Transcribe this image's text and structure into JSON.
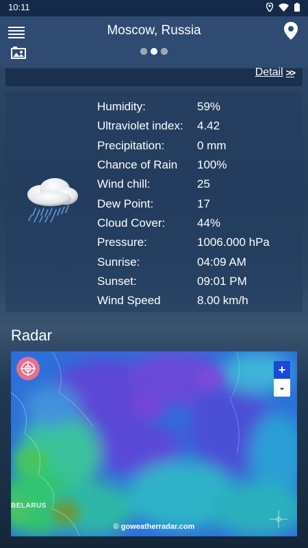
{
  "status_bar": {
    "time": "10:11"
  },
  "header": {
    "location": "Moscow, Russia",
    "page_dots": 3,
    "active_dot": 1
  },
  "detail": {
    "label": "Detail"
  },
  "weather_details": [
    {
      "label": "Humidity:",
      "value": "59%"
    },
    {
      "label": "Ultraviolet index:",
      "value": "4.42"
    },
    {
      "label": "Precipitation:",
      "value": "0 mm"
    },
    {
      "label": "Chance of Rain",
      "value": "100%"
    },
    {
      "label": "Wind chill:",
      "value": "25"
    },
    {
      "label": "Dew Point:",
      "value": "17"
    },
    {
      "label": "Cloud Cover:",
      "value": "44%"
    },
    {
      "label": "Pressure:",
      "value": "1006.000 hPa"
    },
    {
      "label": "Sunrise:",
      "value": "04:09 AM"
    },
    {
      "label": "Sunset:",
      "value": "09:01 PM"
    },
    {
      "label": "Wind Speed",
      "value": "8.00 km/h"
    }
  ],
  "radar": {
    "title": "Radar",
    "zoom_in_label": "+",
    "zoom_out_label": "-",
    "map_label": "BELARUS",
    "credit": "© goweatherradar.com"
  },
  "icons": {
    "menu": "menu-icon",
    "photo": "image-icon",
    "pin": "location-pin-icon",
    "weather": "rain-cloud-icon",
    "radar_logo": "radar-target-icon",
    "crosshair": "crosshair-icon"
  }
}
